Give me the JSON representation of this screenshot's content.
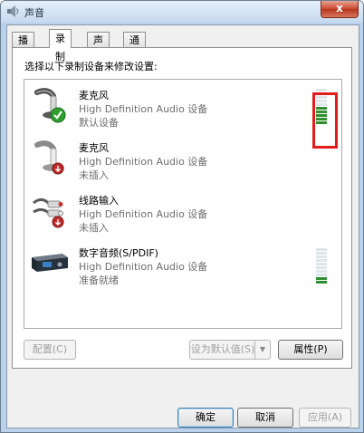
{
  "window": {
    "title": "声音",
    "close_label": "x"
  },
  "tabs": [
    {
      "label": "播放"
    },
    {
      "label": "录制"
    },
    {
      "label": "声音"
    },
    {
      "label": "通信"
    }
  ],
  "instruction": "选择以下录制设备来修改设置:",
  "devices": [
    {
      "name": "麦克风",
      "driver": "High Definition Audio 设备",
      "status": "默认设备",
      "icon": "microphone-default-icon"
    },
    {
      "name": "麦克风",
      "driver": "High Definition Audio 设备",
      "status": "未插入",
      "icon": "microphone-unplugged-icon"
    },
    {
      "name": "线路输入",
      "driver": "High Definition Audio 设备",
      "status": "未插入",
      "icon": "line-in-cable-icon"
    },
    {
      "name": "数字音频(S/PDIF)",
      "driver": "High Definition Audio 设备",
      "status": "准备就绪",
      "icon": "digital-audio-device-icon"
    }
  ],
  "meters": {
    "microphone_level_segments_on": 5,
    "microphone_level_segments_total": 10,
    "spdif_level_segments_on": 2,
    "spdif_level_segments_total": 10
  },
  "buttons": {
    "configure": "配置(C)",
    "set_default": "设为默认值(S)",
    "properties": "属性(P)",
    "ok": "确定",
    "cancel": "取消",
    "apply": "应用(A)"
  },
  "colors": {
    "highlight_box": "#e21c1c",
    "meter_on": "#2f8f2f",
    "meter_off": "#dfe6ea"
  }
}
